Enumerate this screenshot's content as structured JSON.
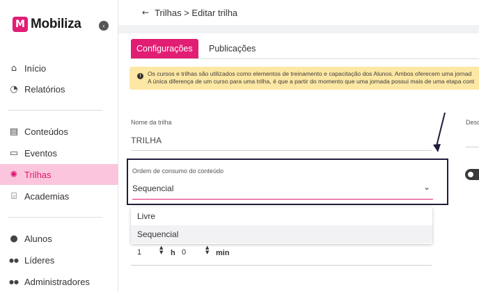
{
  "sidebar": {
    "brand": "Mobiliza",
    "logo_mark": "M",
    "collapse_icon": "‹",
    "items": [
      {
        "label": "Início",
        "icon": "⌂",
        "icon_name": "home-icon"
      },
      {
        "label": "Relatórios",
        "icon": "◔",
        "icon_name": "pie-chart-icon"
      },
      {
        "label": "Conteúdos",
        "icon": "▤",
        "icon_name": "archive-icon"
      },
      {
        "label": "Eventos",
        "icon": "▭",
        "icon_name": "presentation-icon"
      },
      {
        "label": "Trilhas",
        "icon": "✺",
        "icon_name": "trail-icon"
      },
      {
        "label": "Academias",
        "icon": "⌸",
        "icon_name": "institution-icon"
      },
      {
        "label": "Alunos",
        "icon": "●",
        "icon_name": "user-icon"
      },
      {
        "label": "Líderes",
        "icon": "●●",
        "icon_name": "users-icon"
      },
      {
        "label": "Administradores",
        "icon": "●●",
        "icon_name": "admins-icon"
      }
    ],
    "active_color": "#fbc6dd",
    "accent": "#e0156f"
  },
  "breadcrumb": {
    "back_icon": "←",
    "path": "Trilhas > Editar trilha"
  },
  "tabs": [
    {
      "label": "Configurações",
      "active": true
    },
    {
      "label": "Publicações",
      "active": false
    }
  ],
  "alert": {
    "icon": "!",
    "line1": "Os cursos e trilhas são utilizados como elementos de treinamento e capacitação dos Alunos. Ambos oferecem uma jornad",
    "line2": "A única diferença de um curso para uma trilha, é que a partir do momento que uma jornada possui mais de uma etapa cont"
  },
  "form": {
    "name_label": "Nome da trilha",
    "name_value": "TRILHA",
    "desc_label": "Desc",
    "order_label": "Ordem de consumo do conteúdo",
    "order_value": "Sequencial",
    "chevron": "⌄",
    "options": [
      "Livre",
      "Sequencial"
    ],
    "duration_hours": "1",
    "duration_minutes": "0",
    "hours_unit": "h",
    "minutes_unit": "min",
    "spin_icon": "▲▼"
  },
  "colors": {
    "primary": "#e11d74",
    "alert_bg": "#fde7a4",
    "highlight_border": "#1d1d3a"
  }
}
